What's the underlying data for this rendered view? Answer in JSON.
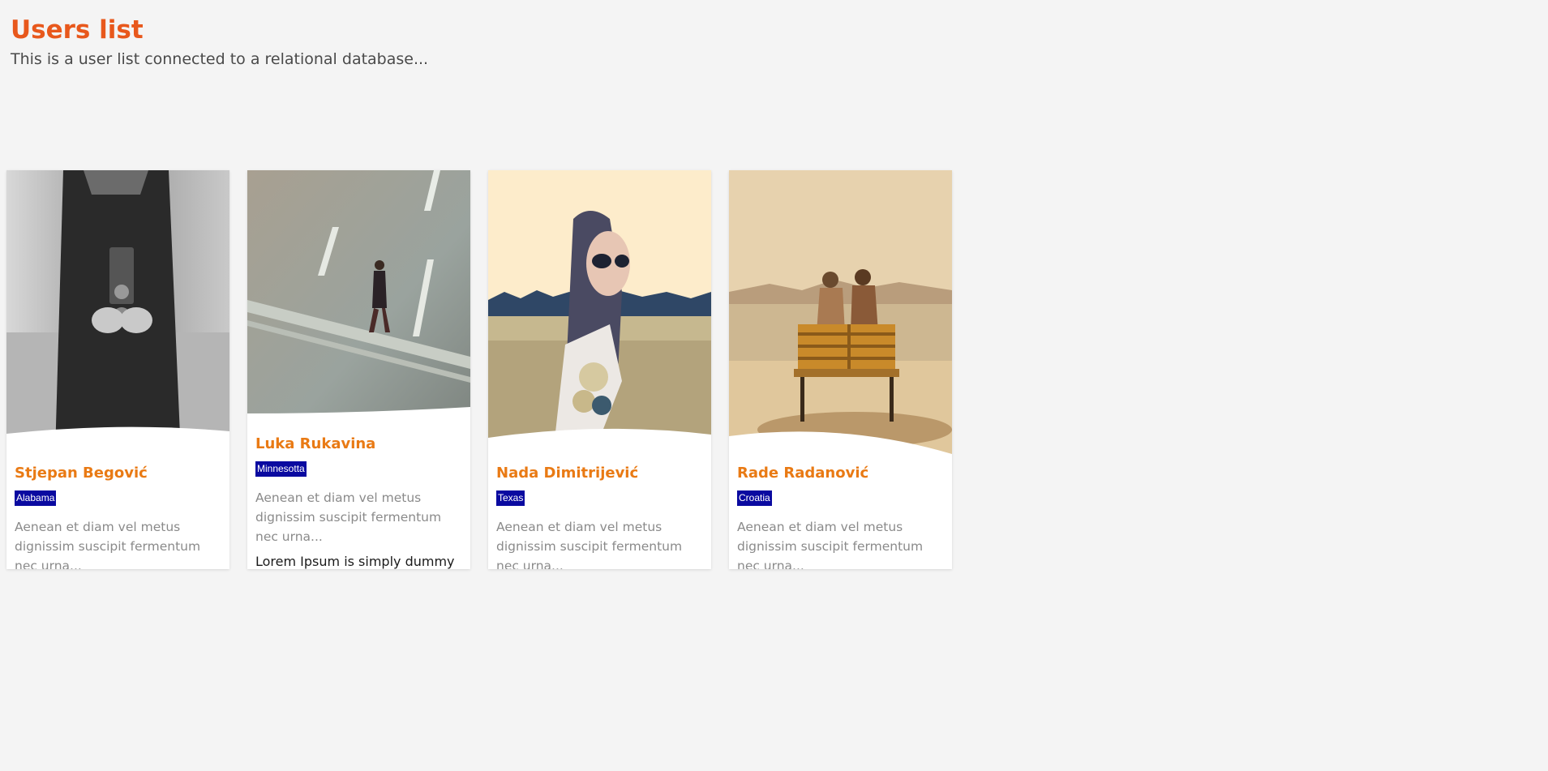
{
  "header": {
    "title": "Users list",
    "subtitle": "This is a user list connected to a relational database..."
  },
  "colors": {
    "accent": "#e8581c",
    "name": "#e97a14",
    "badge": "#0a0aa0",
    "background": "#f4f4f4"
  },
  "users": [
    {
      "name": "Stjepan Begović",
      "location": "Alabama",
      "description": "Aenean et diam vel metus dignissim suscipit fermentum nec urna...",
      "photo_icon": "photographer-photo"
    },
    {
      "name": "Luka Rukavina",
      "location": "Minnesotta",
      "description": "Aenean et diam vel metus dignissim suscipit fermentum nec urna...",
      "extra": "Lorem Ipsum is simply dummy text of the printing and typesetting",
      "photo_icon": "road-walker-photo"
    },
    {
      "name": "Nada Dimitrijević",
      "location": "Texas",
      "description": "Aenean et diam vel metus dignissim suscipit fermentum nec urna...",
      "photo_icon": "woman-sunglasses-photo"
    },
    {
      "name": "Rade Radanović",
      "location": "Croatia",
      "description": "Aenean et diam vel metus dignissim suscipit fermentum nec urna...",
      "photo_icon": "bench-couple-photo"
    }
  ]
}
